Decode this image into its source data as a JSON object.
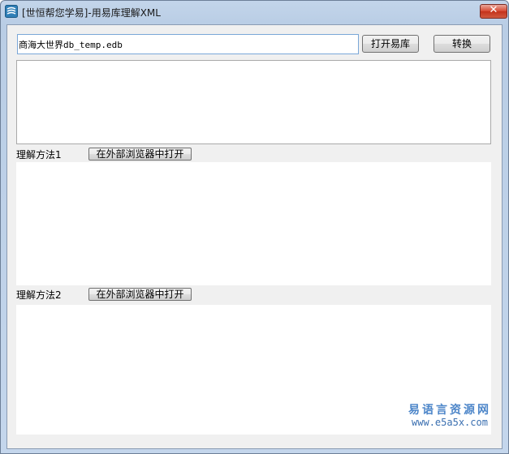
{
  "window": {
    "title": "[世恒帮您学易]-用易库理解XML",
    "close_label": "✕"
  },
  "toolbar": {
    "path_value": "商海大世界db_temp.edb",
    "open_label": "打开易库",
    "convert_label": "转换"
  },
  "method1": {
    "label": "理解方法1",
    "button_label": "在外部浏览器中打开"
  },
  "method2": {
    "label": "理解方法2",
    "button_label": "在外部浏览器中打开"
  },
  "watermark": {
    "brand": "易语言资源网",
    "url": "www.e5a5x.com"
  }
}
